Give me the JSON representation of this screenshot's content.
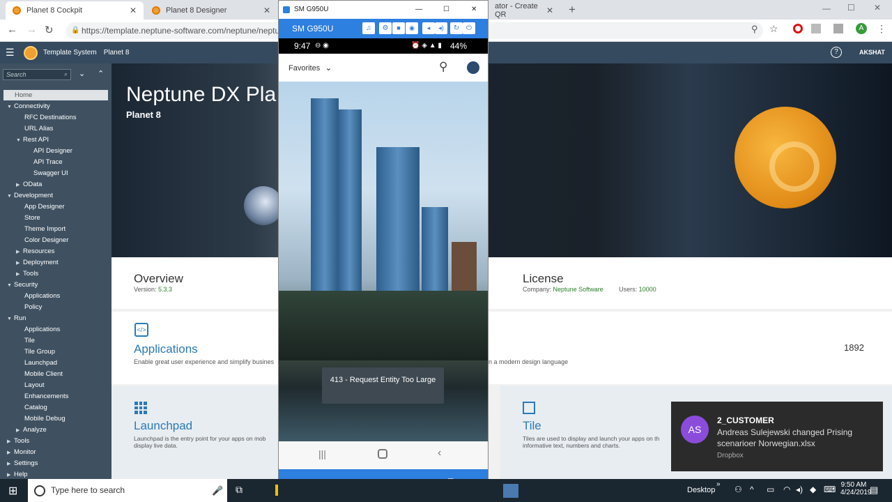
{
  "browser": {
    "tabs": [
      {
        "label": "Planet 8 Cockpit"
      },
      {
        "label": "Planet 8 Designer"
      },
      {
        "label": "ator - Create QR"
      }
    ],
    "url": "https://template.neptune-software.com/neptune/neptu"
  },
  "shell": {
    "system": "Template System",
    "planet": "Planet 8",
    "user": "AKSHAT"
  },
  "sidebar": {
    "search_placeholder": "Search",
    "items": [
      "Home",
      "Connectivity",
      "RFC Destinations",
      "URL Alias",
      "Rest API",
      "API Designer",
      "API Trace",
      "Swagger UI",
      "OData",
      "Development",
      "App Designer",
      "Store",
      "Theme Import",
      "Color Designer",
      "Resources",
      "Deployment",
      "Tools",
      "Security",
      "Applications",
      "Policy",
      "Run",
      "Applications",
      "Tile",
      "Tile Group",
      "Launchpad",
      "Mobile Client",
      "Layout",
      "Enhancements",
      "Catalog",
      "Mobile Debug",
      "Analyze",
      "Tools",
      "Monitor",
      "Settings",
      "Help"
    ]
  },
  "main": {
    "title": "Neptune DX Pla",
    "subtitle": "Planet 8",
    "overview": {
      "title": "Overview",
      "version_label": "Version:",
      "version": "5.3.3"
    },
    "license": {
      "title": "License",
      "company_label": "Company:",
      "company": "Neptune Software",
      "users_label": "Users:",
      "users": "10000"
    },
    "applications": {
      "title": "Applications",
      "desc": "Enable great user experience and simplify busines",
      "desc_right": "n a modern design language",
      "count": "1892"
    },
    "launchpad": {
      "title": "Launchpad",
      "desc": "Launchpad is the entry point for your apps on mob",
      "desc2": "display live data."
    },
    "tile": {
      "title": "Tile",
      "desc": "Tiles are used to display and launch your apps on th",
      "desc2": "informative text, numbers and charts."
    }
  },
  "phone": {
    "window_title": "SM G950U",
    "device": "SM G950U",
    "time": "9:47",
    "battery": "44%",
    "favorites": "Favorites",
    "toast": "413 - Request Entity Too Large"
  },
  "notification": {
    "avatar": "AS",
    "title": "2_CUSTOMER",
    "body": "Andreas Sulejewski changed Prising scenarioer Norwegian.xlsx",
    "source": "Dropbox"
  },
  "taskbar": {
    "search_placeholder": "Type here to search",
    "desktop": "Desktop",
    "time": "9:50 AM",
    "date": "4/24/2019"
  }
}
